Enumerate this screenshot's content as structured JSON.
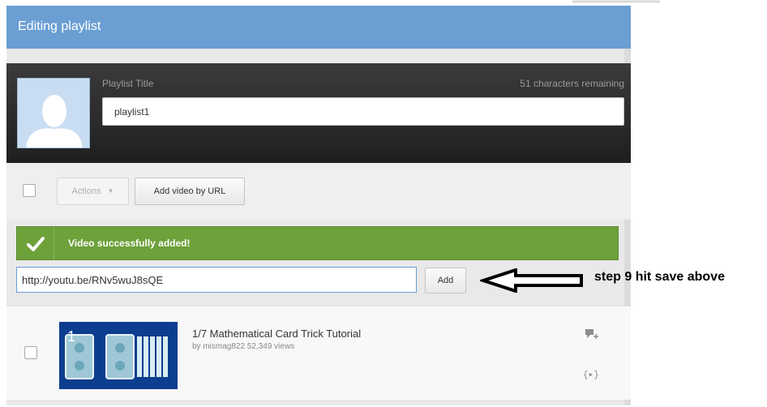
{
  "header": {
    "title": "Editing playlist"
  },
  "playlist": {
    "title_label": "Playlist Title",
    "chars_remaining": "51 characters remaining",
    "title_value": "playlist1",
    "avatar_icon": "person-silhouette-icon"
  },
  "toolbar": {
    "actions_label": "Actions",
    "add_by_url_label": "Add video by URL"
  },
  "notification": {
    "message": "Video successfully added!",
    "icon": "checkmark-icon",
    "color": "#6da13a"
  },
  "add_form": {
    "url_value": "http://youtu.be/RNv5wuJ8sQE",
    "add_label": "Add"
  },
  "annotation": {
    "text": "step 9  hit save above",
    "icon": "left-arrow-icon"
  },
  "videos": [
    {
      "index_label": "1",
      "title": "1/7 Mathematical Card Trick Tutorial",
      "meta": "by mismag822  52,349 views",
      "note_icon": "add-note-icon",
      "move_icon_text": "{▸}"
    }
  ]
}
